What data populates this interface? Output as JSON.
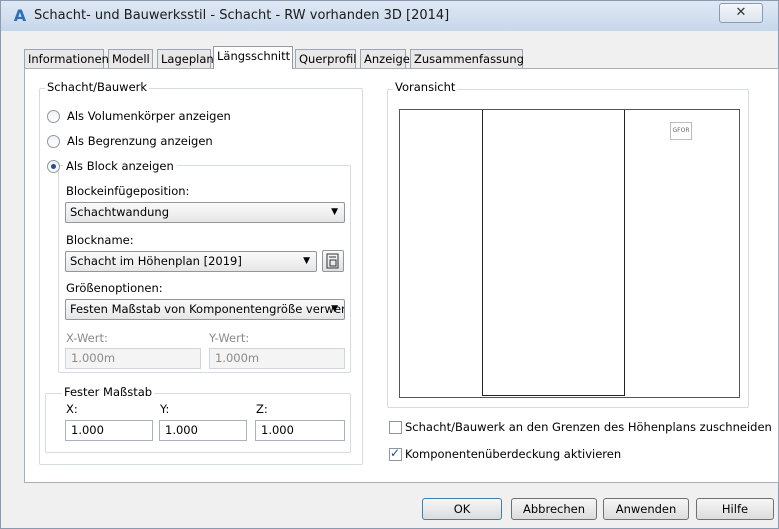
{
  "window": {
    "title": "Schacht- und Bauwerksstil - Schacht - RW vorhanden 3D [2014]",
    "close_symbol": "✕",
    "app_icon": "autocad-civil-icon"
  },
  "tabs": [
    "Informationen",
    "Modell",
    "Lageplan",
    "Längsschnitt",
    "Querprofil",
    "Anzeige",
    "Zusammenfassung"
  ],
  "active_tab": "Längsschnitt",
  "group": {
    "label": "Schacht/Bauwerk",
    "radio_volume": "Als Volumenkörper anzeigen",
    "radio_boundary": "Als Begrenzung anzeigen",
    "radio_block": "Als Block anzeigen",
    "block_insert_label": "Blockeinfügeposition:",
    "block_insert_value": "Schachtwandung",
    "block_name_label": "Blockname:",
    "block_name_value": "Schacht im Höhenplan [2019]",
    "size_options_label": "Größenoptionen:",
    "size_options_value": "Festen Maßstab von Komponentengröße verwen",
    "x_value_label": "X-Wert:",
    "x_value": "1.000m",
    "y_value_label": "Y-Wert:",
    "y_value": "1.000m",
    "fixed_scale_label": "Fester Maßstab",
    "scale_x_label": "X:",
    "scale_x": "1.000",
    "scale_y_label": "Y:",
    "scale_y": "1.000",
    "scale_z_label": "Z:",
    "scale_z": "1.000"
  },
  "preview": {
    "label": "Voransicht",
    "cube_label": "GFOR"
  },
  "checkboxes": {
    "clip": "Schacht/Bauwerk an den Grenzen des Höhenplans zuschneiden",
    "clip_checked": false,
    "cover": "Komponentenüberdeckung aktivieren",
    "cover_checked": true
  },
  "buttons": {
    "ok": "OK",
    "cancel": "Abbrechen",
    "apply": "Anwenden",
    "help": "Hilfe"
  }
}
